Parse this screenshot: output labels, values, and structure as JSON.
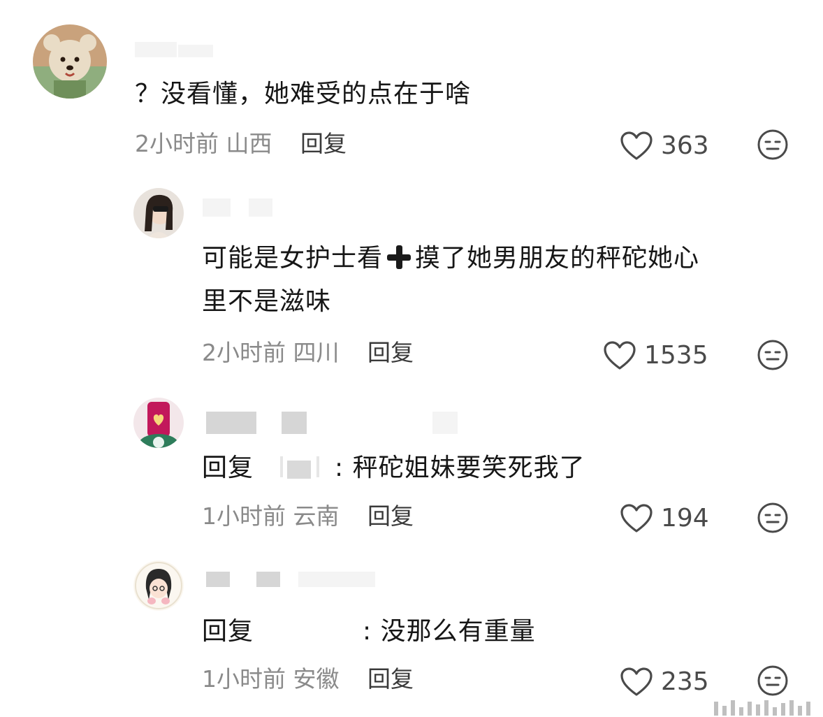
{
  "comments": [
    {
      "text": "？没看懂，她难受的点在于啥",
      "time": "2小时前",
      "location": "山西",
      "reply_label": "回复",
      "likes": "363",
      "avatar": "teddy-bear-avatar"
    },
    {
      "text_before": "可能是女护士看",
      "emoji": "heavy-plus-emoji",
      "text_after": "摸了她男朋友的秤砣她心",
      "text_line2": "里不是滋味",
      "time": "2小时前",
      "location": "四川",
      "reply_label": "回复",
      "likes": "1535",
      "avatar": "girl-photo-avatar"
    },
    {
      "reply_prefix": "回复",
      "text": ": 秤砣姐妹要笑死我了",
      "time": "1小时前",
      "location": "云南",
      "reply_label": "回复",
      "likes": "194",
      "avatar": "drink-cup-avatar"
    },
    {
      "reply_prefix": "回复",
      "text": ": 没那么有重量",
      "time": "1小时前",
      "location": "安徽",
      "reply_label": "回复",
      "likes": "235",
      "avatar": "cartoon-girl-avatar"
    }
  ],
  "colors": {
    "meta_gray": "#8a8a8a",
    "text_dark": "#161616",
    "icon_gray": "#4a4a4a"
  }
}
